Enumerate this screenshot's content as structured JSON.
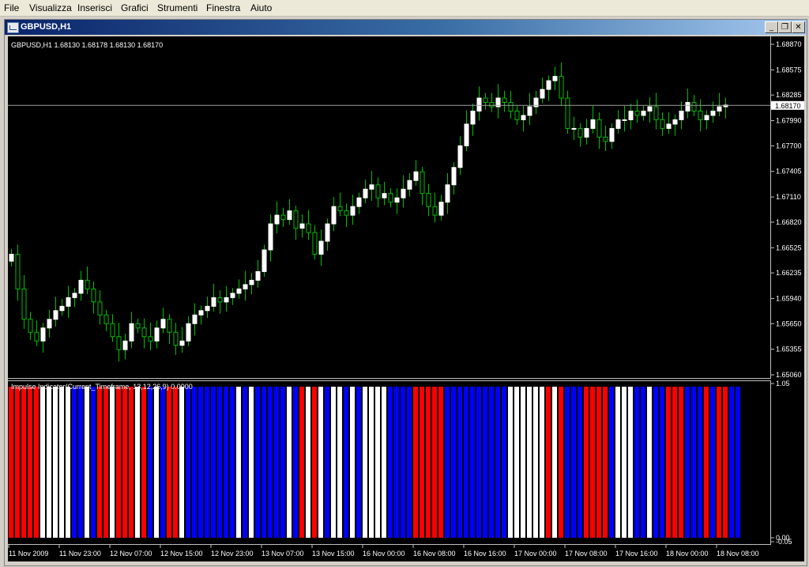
{
  "menu": [
    "File",
    "Visualizza",
    "Inserisci",
    "Grafici",
    "Strumenti",
    "Finestra",
    "Aiuto"
  ],
  "window": {
    "title": "GBPUSD,H1",
    "btn_minimize": "_",
    "btn_restore": "❐",
    "btn_close": "✕"
  },
  "price_panel": {
    "header": "GBPUSD,H1  1.68130 1.68178 1.68130 1.68170",
    "price_ticks": [
      "1.68870",
      "1.68575",
      "1.68285",
      "1.67990",
      "1.67700",
      "1.67405",
      "1.67110",
      "1.66820",
      "1.66525",
      "1.66235",
      "1.65940",
      "1.65650",
      "1.65355",
      "1.65060"
    ],
    "current_price": "1.68170"
  },
  "indicator_panel": {
    "header": "Impulse Indicator(Current_Timeframe, 13,12,26,9) 0.0000",
    "ticks": [
      "1.05",
      "0.00",
      "-0.05"
    ]
  },
  "time_axis": [
    "11 Nov 2009",
    "11 Nov 23:00",
    "12 Nov 07:00",
    "12 Nov 15:00",
    "12 Nov 23:00",
    "13 Nov 07:00",
    "13 Nov 15:00",
    "16 Nov 00:00",
    "16 Nov 08:00",
    "16 Nov 16:00",
    "17 Nov 00:00",
    "17 Nov 08:00",
    "17 Nov 16:00",
    "18 Nov 00:00",
    "18 Nov 08:00"
  ],
  "colors": {
    "background": "#000000",
    "bull_candle": "#ffffff",
    "wick": "#00c000",
    "impulse_up": "#ff0000",
    "impulse_down": "#0000ff",
    "impulse_neutral": "#ffffff",
    "window_frame": "#d4d0c8"
  },
  "chart_data": {
    "type": "candlestick",
    "price_range": [
      1.6506,
      1.6887
    ],
    "closes": [
      1.6645,
      1.6605,
      1.657,
      1.6555,
      1.6545,
      1.656,
      1.657,
      1.658,
      1.6585,
      1.6595,
      1.66,
      1.6615,
      1.6605,
      1.659,
      1.6575,
      1.6565,
      1.655,
      1.6535,
      1.6545,
      1.6565,
      1.656,
      1.655,
      1.6545,
      1.656,
      1.657,
      1.6555,
      1.654,
      1.6545,
      1.6565,
      1.6575,
      1.658,
      1.6585,
      1.6595,
      1.659,
      1.6595,
      1.66,
      1.6605,
      1.661,
      1.6615,
      1.6625,
      1.665,
      1.668,
      1.669,
      1.6685,
      1.6695,
      1.6675,
      1.668,
      1.667,
      1.6645,
      1.666,
      1.668,
      1.67,
      1.6695,
      1.669,
      1.67,
      1.671,
      1.672,
      1.6725,
      1.671,
      1.6715,
      1.6705,
      1.671,
      1.672,
      1.673,
      1.674,
      1.6715,
      1.67,
      1.669,
      1.6705,
      1.6725,
      1.6745,
      1.677,
      1.6795,
      1.681,
      1.6825,
      1.682,
      1.6815,
      1.6825,
      1.682,
      1.681,
      1.68,
      1.6805,
      1.6815,
      1.6825,
      1.6835,
      1.6845,
      1.685,
      1.6825,
      1.679,
      1.679,
      1.678,
      1.679,
      1.68,
      1.678,
      1.6775,
      1.679,
      1.68,
      1.68,
      1.681,
      1.6805,
      1.681,
      1.6815,
      1.68,
      1.679,
      1.6795,
      1.68,
      1.681,
      1.682,
      1.681,
      1.68,
      1.6805,
      1.681,
      1.6815,
      1.6817
    ],
    "impulse": "RRRRRWWWWWBBWBRRWRRRWRBWBRRWBBBBBBBBWBWBBBBBWBRWRWBWWBWBWWWWBBBBRRRRRBBBBBBBBBBWWWWWWRWRBBBRRRRBWWWBBWBBRRRBBBRBRRBB"
  }
}
